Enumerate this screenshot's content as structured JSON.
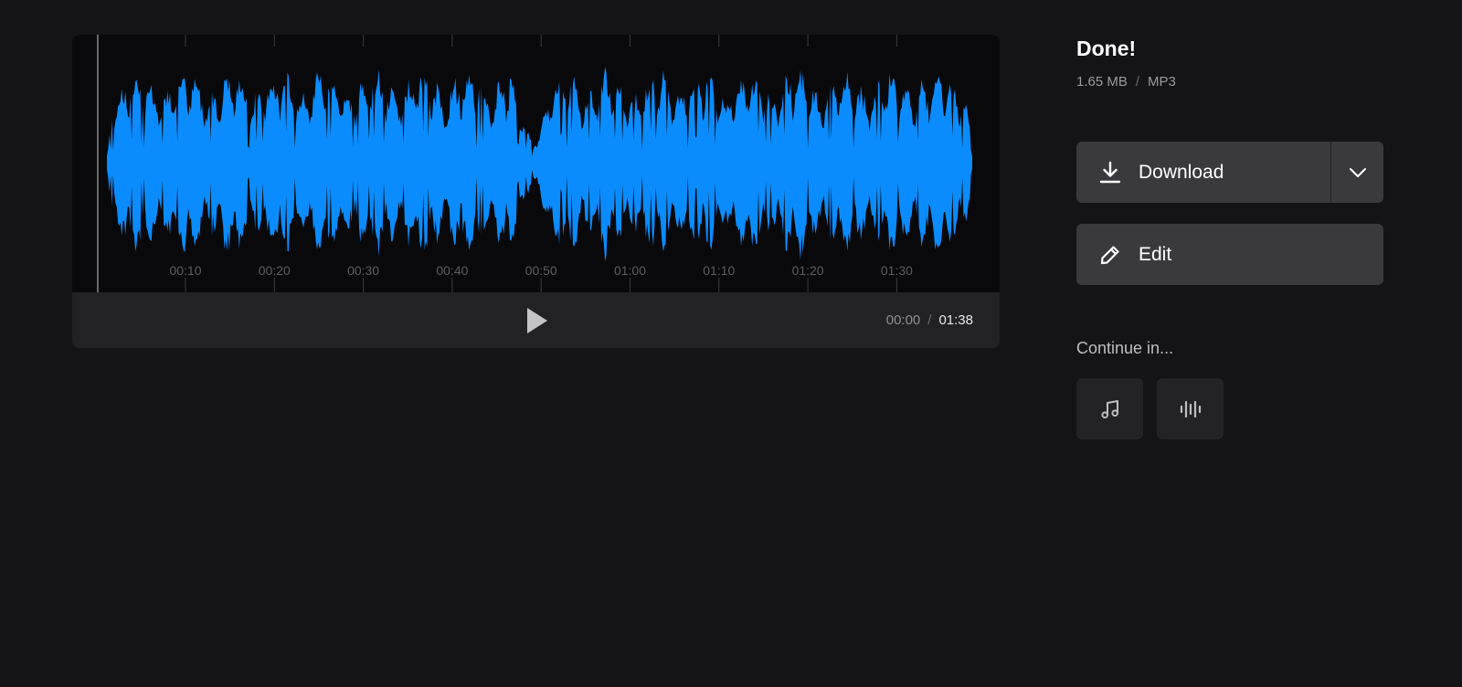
{
  "player": {
    "timeline_ticks": [
      "00:10",
      "00:20",
      "00:30",
      "00:40",
      "00:50",
      "01:00",
      "01:10",
      "01:20",
      "01:30"
    ],
    "current_time": "00:00",
    "time_separator": "/",
    "total_time": "01:38",
    "waveform_color": "#0a8cff",
    "play_icon": "play-icon"
  },
  "result": {
    "title": "Done!",
    "file_size": "1.65 MB",
    "meta_separator": "/",
    "file_format": "MP3"
  },
  "actions": {
    "download_label": "Download",
    "download_icon": "download-icon",
    "dropdown_icon": "chevron-down-icon",
    "edit_label": "Edit",
    "edit_icon": "pencil-icon"
  },
  "continue_in": {
    "label": "Continue in...",
    "tools": [
      {
        "icon": "music-note-icon"
      },
      {
        "icon": "voice-waveform-icon"
      }
    ]
  },
  "colors": {
    "background": "#141417",
    "accent": "#0a8cff",
    "button": "#3a3a3e",
    "tile": "#232327"
  }
}
